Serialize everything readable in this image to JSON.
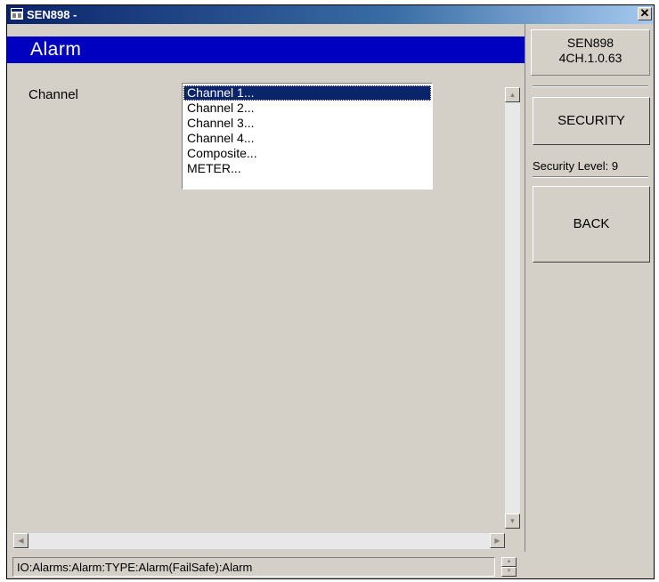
{
  "window": {
    "title": "SEN898 -",
    "close_glyph": "✕"
  },
  "page": {
    "heading": "Alarm",
    "channel_label": "Channel"
  },
  "channel_list": {
    "items": [
      "Channel 1...",
      "Channel 2...",
      "Channel 3...",
      "Channel 4...",
      "Composite...",
      "METER..."
    ],
    "selected": "Channel 1..."
  },
  "sidebar": {
    "device_name": "SEN898",
    "version": "4CH.1.0.63",
    "security_button": "SECURITY",
    "security_level": "Security Level: 9",
    "back_button": "BACK"
  },
  "status": {
    "path": "IO:Alarms:Alarm:TYPE:Alarm(FailSafe):Alarm"
  },
  "icons": {
    "app": "window-app-icon",
    "close": "close-icon",
    "scroll_up": "arrow-up-icon",
    "scroll_down": "arrow-down-icon",
    "scroll_left": "arrow-left-icon",
    "scroll_right": "arrow-right-icon"
  },
  "colors": {
    "heading_bg": "#0000c0",
    "title_bar": "#0a246a",
    "selection": "#0a246a",
    "face": "#d4d0c8"
  }
}
